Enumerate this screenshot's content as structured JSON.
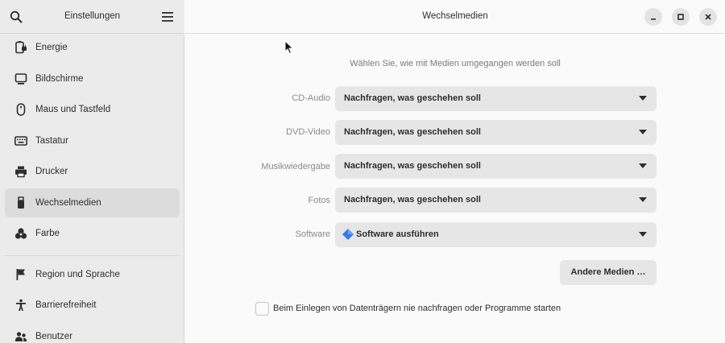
{
  "sidebar": {
    "title": "Einstellungen",
    "items": [
      {
        "label": "Energie",
        "icon": "battery-plug-icon"
      },
      {
        "label": "Bildschirme",
        "icon": "monitor-icon"
      },
      {
        "label": "Maus und Tastfeld",
        "icon": "mouse-icon"
      },
      {
        "label": "Tastatur",
        "icon": "keyboard-icon"
      },
      {
        "label": "Drucker",
        "icon": "printer-icon"
      },
      {
        "label": "Wechselmedien",
        "icon": "usb-stick-icon",
        "active": true
      },
      {
        "label": "Farbe",
        "icon": "color-icon"
      },
      {
        "label": "Region und Sprache",
        "icon": "flag-icon"
      },
      {
        "label": "Barrierefreiheit",
        "icon": "accessibility-icon"
      },
      {
        "label": "Benutzer",
        "icon": "users-icon"
      }
    ]
  },
  "header": {
    "title": "Wechselmedien"
  },
  "main": {
    "subtitle": "Wählen Sie, wie mit Medien umgegangen werden soll",
    "rows": [
      {
        "label": "CD-Audio",
        "value": "Nachfragen, was geschehen soll"
      },
      {
        "label": "DVD-Video",
        "value": "Nachfragen, was geschehen soll"
      },
      {
        "label": "Musikwiedergabe",
        "value": "Nachfragen, was geschehen soll"
      },
      {
        "label": "Fotos",
        "value": "Nachfragen, was geschehen soll"
      },
      {
        "label": "Software",
        "value": "Software ausführen",
        "value_icon": "software-diamond-icon"
      }
    ],
    "other_media_button": "Andere Medien …",
    "never_prompt_label": "Beim Einlegen von Datenträgern nie nachfragen oder Programme starten",
    "never_prompt_checked": false
  },
  "colors": {
    "sidebar_bg": "#ebebeb",
    "active_item_bg": "#dcdcdc",
    "content_bg": "#fafafa",
    "dropdown_bg": "#e6e6e6",
    "software_icon": "#3b7be0"
  }
}
